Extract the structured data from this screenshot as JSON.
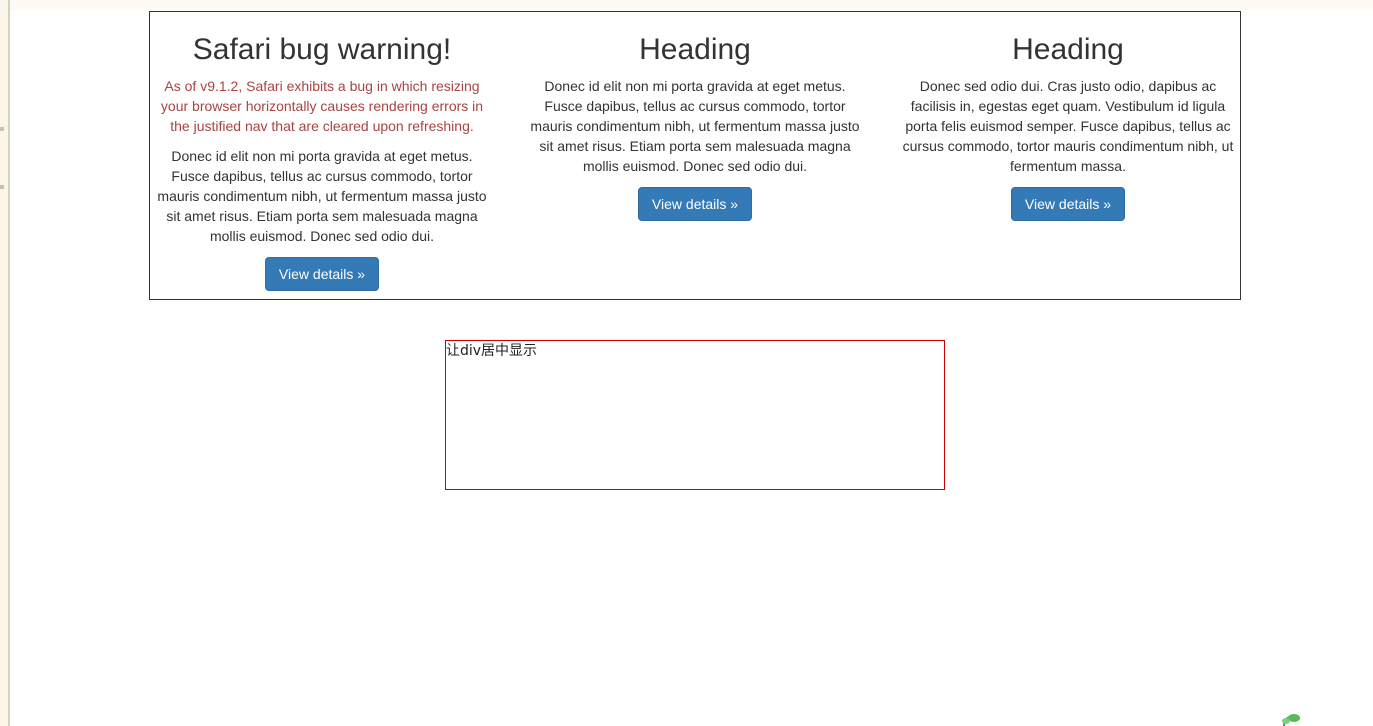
{
  "columns": [
    {
      "heading": "Safari bug warning!",
      "warning": "As of v9.1.2, Safari exhibits a bug in which resizing your browser horizontally causes rendering errors in the justified nav that are cleared upon refreshing.",
      "body": "Donec id elit non mi porta gravida at eget metus. Fusce dapibus, tellus ac cursus commodo, tortor mauris condimentum nibh, ut fermentum massa justo sit amet risus. Etiam porta sem malesuada magna mollis euismod. Donec sed odio dui.",
      "button_label": "View details »"
    },
    {
      "heading": "Heading",
      "body": "Donec id elit non mi porta gravida at eget metus. Fusce dapibus, tellus ac cursus commodo, tortor mauris condimentum nibh, ut fermentum massa justo sit amet risus. Etiam porta sem malesuada magna mollis euismod. Donec sed odio dui.",
      "button_label": "View details »"
    },
    {
      "heading": "Heading",
      "body": "Donec sed odio dui. Cras justo odio, dapibus ac facilisis in, egestas eget quam. Vestibulum id ligula porta felis euismod semper. Fusce dapibus, tellus ac cursus commodo, tortor mauris condimentum nibh, ut fermentum massa.",
      "button_label": "View details »"
    }
  ],
  "center_box": {
    "text": "让div居中显示"
  },
  "colors": {
    "button_bg": "#337ab7",
    "warning_text": "#a94442",
    "center_box_border": "#cc0000",
    "container_border": "#333333"
  },
  "icons": {
    "corner_decoration": "leaf-icon"
  }
}
